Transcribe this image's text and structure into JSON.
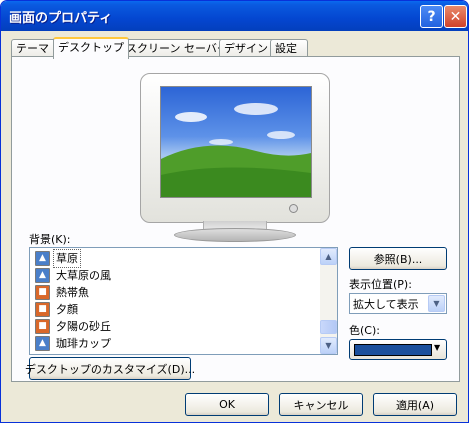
{
  "window": {
    "title": "画面のプロパティ",
    "help_label": "?",
    "close_label": "✕"
  },
  "tabs": [
    {
      "label": "テーマ"
    },
    {
      "label": "デスクトップ"
    },
    {
      "label": "スクリーン セーバー"
    },
    {
      "label": "デザイン"
    },
    {
      "label": "設定"
    }
  ],
  "background": {
    "label": "背景(K):",
    "items": [
      {
        "label": "草原",
        "icon": "wallpaper-image-icon"
      },
      {
        "label": "大草原の風",
        "icon": "wallpaper-image-icon"
      },
      {
        "label": "熱帯魚",
        "icon": "wallpaper-photo-icon"
      },
      {
        "label": "夕顔",
        "icon": "wallpaper-photo-icon"
      },
      {
        "label": "夕陽の砂丘",
        "icon": "wallpaper-photo-icon"
      },
      {
        "label": "珈琲カップ",
        "icon": "wallpaper-image-icon"
      }
    ],
    "browse_label": "参照(B)...",
    "customize_label": "デスクトップのカスタマイズ(D)..."
  },
  "position": {
    "label": "表示位置(P):",
    "value": "拡大して表示"
  },
  "color": {
    "label": "色(C):",
    "value_hex": "#1a4f9c"
  },
  "footer": {
    "ok_label": "OK",
    "cancel_label": "キャンセル",
    "apply_label": "適用(A)"
  },
  "colors": {
    "titlebar": "#0446d0",
    "dialog_bg": "#ece9d8",
    "tab_accent": "#ffc83c"
  }
}
